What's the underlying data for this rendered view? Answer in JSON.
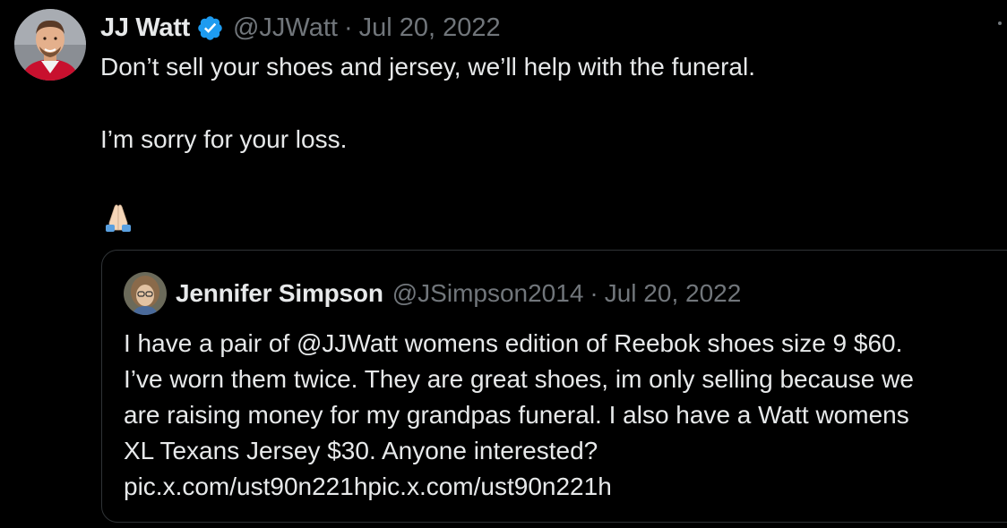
{
  "tweet": {
    "author_name": "JJ Watt",
    "handle": "@JJWatt",
    "separator": "·",
    "date": "Jul 20, 2022",
    "body_lines": [
      "Don’t sell your shoes and jersey, we’ll help with the funeral.",
      "I’m sorry for your loss."
    ],
    "emoji_icon": "folded-hands-emoji",
    "avatar_icon": "jj-watt-avatar",
    "verified_icon": "verified-badge-icon",
    "more_icon": "more-options-icon"
  },
  "quote": {
    "author_name": "Jennifer Simpson",
    "handle": "@JSimpson2014",
    "separator": "·",
    "date": "Jul 20, 2022",
    "lines": [
      "I have a pair of @JJWatt womens edition of Reebok shoes size 9 $60.",
      "I’ve worn them twice. They are great shoes, im only selling because we",
      "are raising money for my grandpas funeral. I also have a Watt womens",
      "XL Texans Jersey $30. Anyone interested?",
      "pic.x.com/ust90n221hpic.x.com/ust90n221h"
    ],
    "avatar_icon": "jennifer-simpson-avatar"
  },
  "colors": {
    "background": "#000000",
    "text_primary": "#e7e9ea",
    "text_secondary": "#71767b",
    "verified_blue": "#1d9bf0",
    "border": "#2f3336"
  }
}
